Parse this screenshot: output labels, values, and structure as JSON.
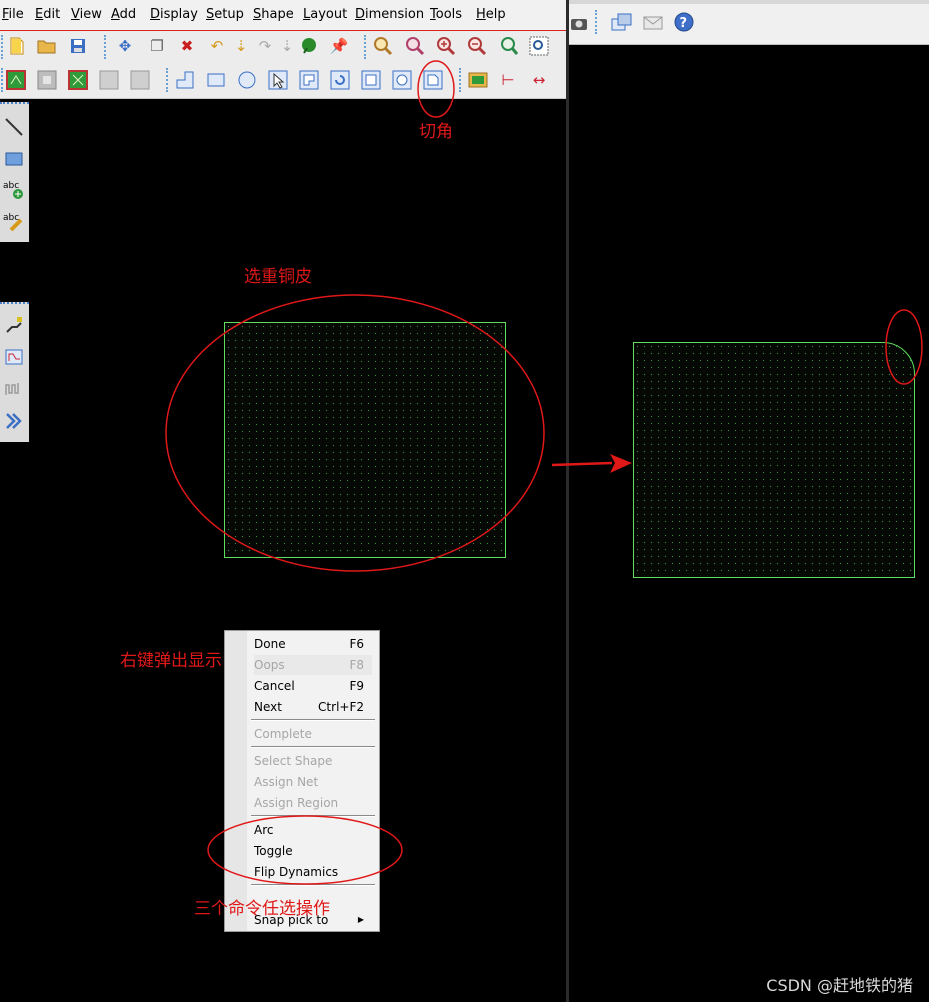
{
  "menu": [
    "File",
    "Edit",
    "View",
    "Add",
    "Display",
    "Setup",
    "Shape",
    "Layout",
    "Dimension",
    "Tools",
    "Help"
  ],
  "toolbar_icons": {
    "row1": [
      "new-file-icon",
      "open-folder-icon",
      "save-icon",
      "move-icon",
      "copy-icon",
      "delete-icon",
      "undo-icon",
      "down-arrow-icon",
      "redo-icon",
      "down-arrow-gray-icon",
      "ratsnest-icon",
      "pin-icon",
      "zoom-window-icon",
      "zoom-fit-icon",
      "zoom-in-icon",
      "zoom-out-icon",
      "zoom-previous-icon",
      "zoom-select-icon"
    ],
    "row2": [
      "shape-edit-icon",
      "shape-void-icon",
      "shape-merge-icon",
      "shape-gray-a-icon",
      "shape-gray-b-icon",
      "notch-icon",
      "rectangle-icon",
      "circle-icon",
      "select-arrow-icon",
      "polygon-icon",
      "rotate-icon",
      "square-icon",
      "circle-outline-icon",
      "chamfer-corner-icon",
      "design-rule-icon",
      "dimension-a-icon",
      "dimension-b-icon"
    ],
    "right": [
      "camera-icon",
      "windows-icon",
      "mail-icon",
      "help-icon"
    ],
    "left_tools": [
      "line-icon",
      "rectangle-tool-icon",
      "add-text-icon",
      "edit-text-icon",
      "route-icon",
      "fanout-icon",
      "tune-icon",
      "bundle-icon"
    ]
  },
  "context_menu": {
    "items": [
      {
        "label": "Done",
        "key": "F6",
        "disabled": false
      },
      {
        "label": "Oops",
        "key": "F8",
        "disabled": true
      },
      {
        "label": "Cancel",
        "key": "F9",
        "disabled": false
      },
      {
        "label": "Next",
        "key": "Ctrl+F2",
        "disabled": false
      },
      {
        "label": "Complete",
        "key": "",
        "disabled": true
      },
      {
        "label": "Select Shape",
        "key": "",
        "disabled": true
      },
      {
        "label": "Assign Net",
        "key": "",
        "disabled": true
      },
      {
        "label": "Assign Region",
        "key": "",
        "disabled": true
      },
      {
        "label": "Arc",
        "key": "",
        "disabled": false
      },
      {
        "label": "Toggle",
        "key": "",
        "disabled": false
      },
      {
        "label": "Flip Dynamics",
        "key": "",
        "disabled": false
      },
      {
        "label": "Snap pick to",
        "key": "",
        "disabled": false
      }
    ]
  },
  "annotations": {
    "chamfer": "切角",
    "select_copper": "选重铜皮",
    "right_click": "右键弹出显示",
    "three_commands": "三个命令任选操作"
  },
  "watermark": "CSDN @赶地铁的猪",
  "colors": {
    "annotation": "#e01818",
    "copper_outline": "#5ee05e",
    "canvas": "#000000"
  }
}
